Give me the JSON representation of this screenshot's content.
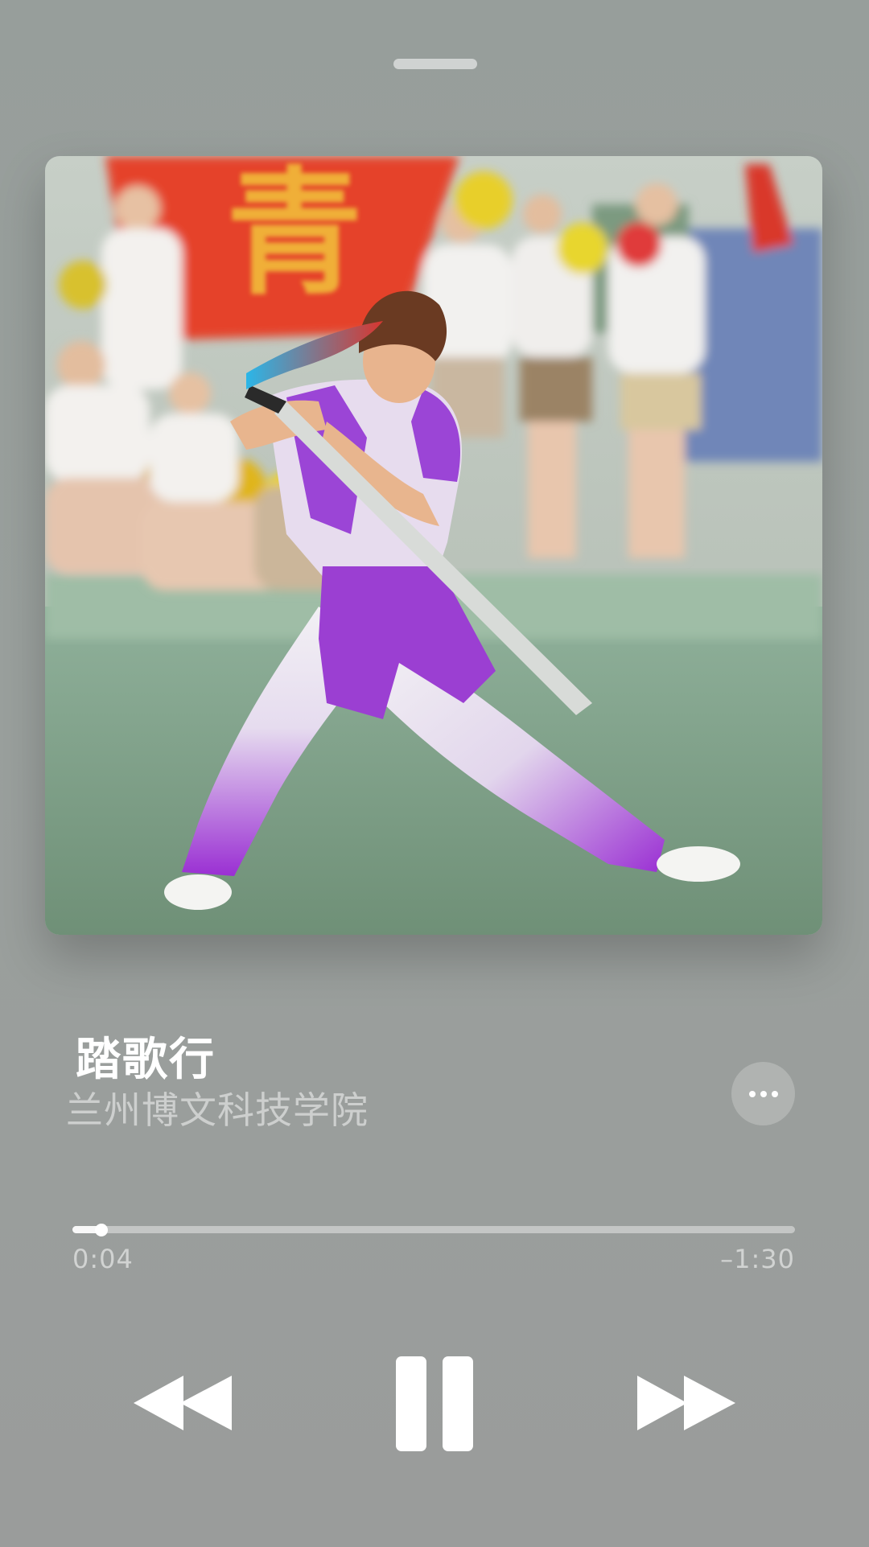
{
  "player": {
    "track_title": "踏歌行",
    "artist": "兰州博文科技学院",
    "elapsed": "0:04",
    "remaining": "–1:30",
    "progress_fraction": 0.04
  },
  "artwork": {
    "banner_char": "青"
  },
  "icons": {
    "grabber": "drag-handle-icon",
    "more": "ellipsis-icon",
    "rewind": "rewind-icon",
    "pause": "pause-icon",
    "forward": "fast-forward-icon"
  },
  "colors": {
    "background": "#999e9c",
    "foreground": "#ffffff"
  }
}
